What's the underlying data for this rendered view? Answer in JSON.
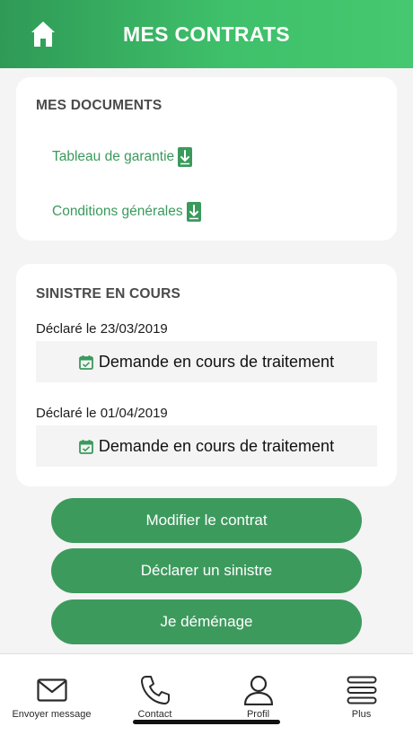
{
  "header": {
    "title": "MES CONTRATS",
    "home_icon": "home-icon",
    "gradient_start": "#2f9a56",
    "gradient_end": "#45c870"
  },
  "documents": {
    "title": "MES DOCUMENTS",
    "items": [
      {
        "label": "Tableau de garantie",
        "icon": "download-icon"
      },
      {
        "label": "Conditions générales",
        "icon": "download-icon"
      }
    ],
    "link_color": "#3a9a5c"
  },
  "sinistre": {
    "title": "SINISTRE EN COURS",
    "claims": [
      {
        "declared": "Déclaré le 23/03/2019",
        "status": "Demande en cours de traitement",
        "icon": "calendar-check-icon"
      },
      {
        "declared": "Déclaré le 01/04/2019",
        "status": "Demande en cours de traitement",
        "icon": "calendar-check-icon"
      }
    ]
  },
  "actions": {
    "modify": "Modifier le contrat",
    "declare": "Déclarer un sinistre",
    "move": "Je déménage",
    "button_color": "#3d9a5d"
  },
  "tabbar": {
    "items": [
      {
        "label": "Envoyer message",
        "icon": "envelope-icon"
      },
      {
        "label": "Contact",
        "icon": "phone-icon"
      },
      {
        "label": "Profil",
        "icon": "user-icon"
      },
      {
        "label": "Plus",
        "icon": "menu-icon"
      }
    ]
  }
}
